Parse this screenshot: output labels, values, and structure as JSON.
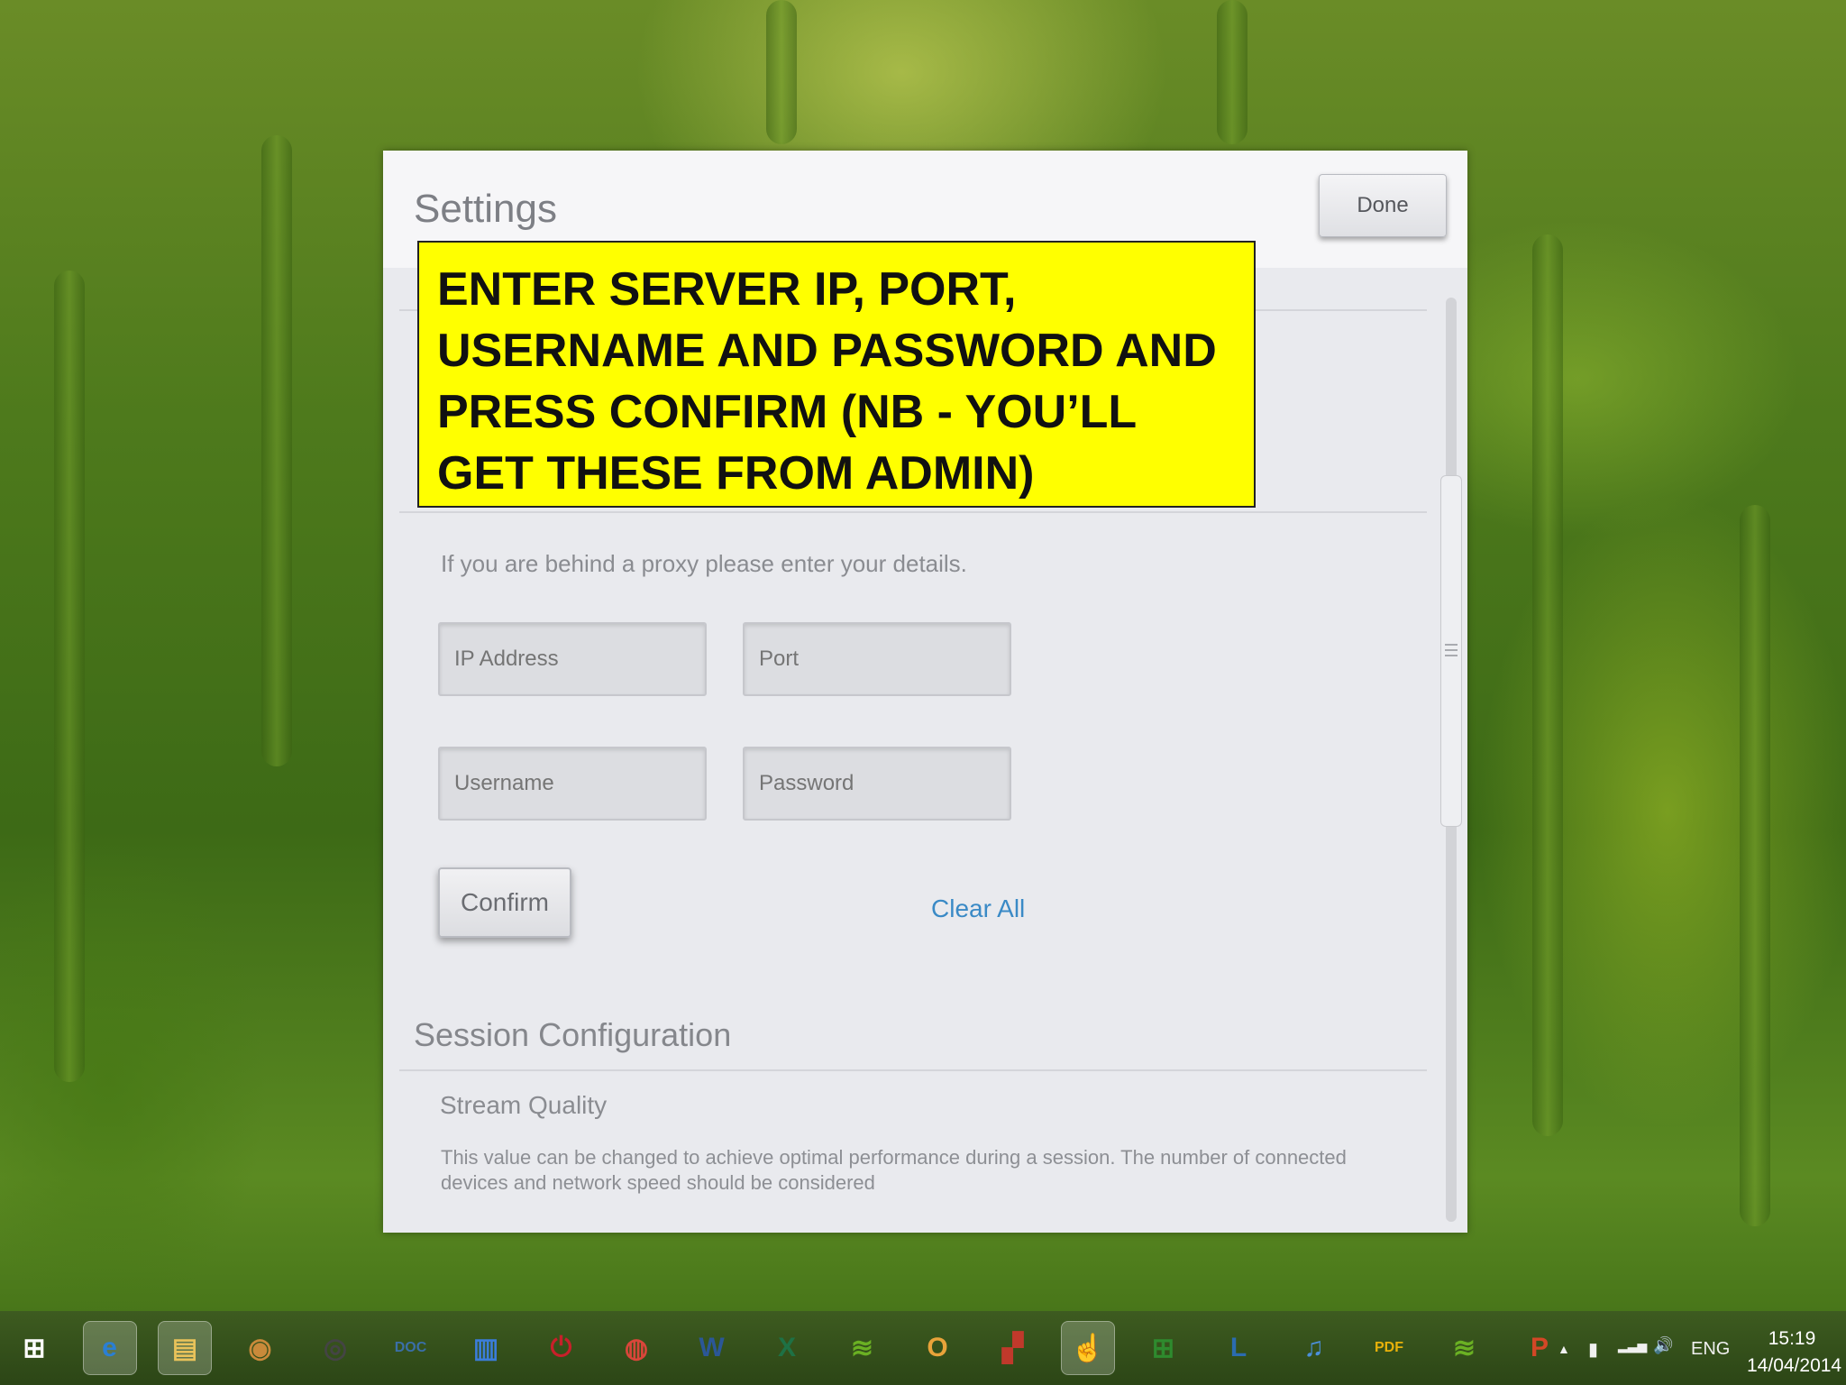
{
  "dialog": {
    "title": "Settings",
    "done_label": "Done",
    "callout": "ENTER SERVER IP, PORT, USERNAME AND PASSWORD AND PRESS CONFIRM (NB  - YOU’LL GET THESE FROM ADMIN)",
    "proxy_hint": "If you are behind a proxy please enter your details.",
    "fields": {
      "ip_placeholder": "IP Address",
      "port_placeholder": "Port",
      "username_placeholder": "Username",
      "password_placeholder": "Password"
    },
    "confirm_label": "Confirm",
    "clear_all_label": "Clear All",
    "session_title": "Session Configuration",
    "stream_quality_label": "Stream Quality",
    "stream_quality_desc": "This value can be changed to achieve optimal performance during a session. The number of connected devices and network speed should be considered"
  },
  "taskbar": {
    "icons": [
      {
        "name": "start-windows-icon",
        "glyph": "⊞",
        "color": "#ffffff"
      },
      {
        "name": "internet-explorer-icon",
        "glyph": "e",
        "color": "#2a7fd4"
      },
      {
        "name": "file-explorer-icon",
        "glyph": "▤",
        "color": "#e8c25a"
      },
      {
        "name": "hard-drive-icon",
        "glyph": "◉",
        "color": "#c98a3a"
      },
      {
        "name": "speaker-icon",
        "glyph": "◎",
        "color": "#444444"
      },
      {
        "name": "doc-converter-icon",
        "glyph": "DOC",
        "color": "#3a6fa8"
      },
      {
        "name": "document-app-icon",
        "glyph": "▥",
        "color": "#3b7dd8"
      },
      {
        "name": "power-icon",
        "glyph": "⏻",
        "color": "#c8202a"
      },
      {
        "name": "chrome-icon",
        "glyph": "◍",
        "color": "#d9463a"
      },
      {
        "name": "word-icon",
        "glyph": "W",
        "color": "#2b5797"
      },
      {
        "name": "excel-icon",
        "glyph": "X",
        "color": "#1e7145"
      },
      {
        "name": "spotify-icon",
        "glyph": "≋",
        "color": "#6ab023"
      },
      {
        "name": "outlook-icon",
        "glyph": "O",
        "color": "#e8a33a"
      },
      {
        "name": "media-app-icon",
        "glyph": "▞",
        "color": "#c0392b"
      },
      {
        "name": "touch-app-icon",
        "glyph": "☝",
        "color": "#5a8fd0"
      },
      {
        "name": "store-icon",
        "glyph": "⊞",
        "color": "#2e8b2e"
      },
      {
        "name": "lync-icon",
        "glyph": "L",
        "color": "#2b6cb0"
      },
      {
        "name": "itunes-icon",
        "glyph": "♫",
        "color": "#4b8fd9"
      },
      {
        "name": "pdf-icon",
        "glyph": "PDF",
        "color": "#e8b10a"
      },
      {
        "name": "spotify-icon-2",
        "glyph": "≋",
        "color": "#6ab023"
      },
      {
        "name": "powerpoint-icon",
        "glyph": "P",
        "color": "#d24726"
      }
    ],
    "active_indices": [
      1,
      2,
      14
    ],
    "tray": {
      "up_arrow": "▲",
      "battery_glyph": "▮",
      "signal_glyph": "▂▃▅",
      "volume_glyph": "🔊",
      "lang": "ENG"
    },
    "clock": {
      "time": "15:19",
      "date": "14/04/2014"
    }
  }
}
